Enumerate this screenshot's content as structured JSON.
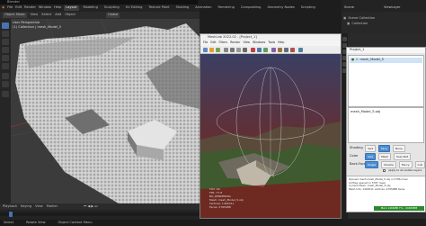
{
  "blender": {
    "title": "Blender",
    "menu": [
      "File",
      "Edit",
      "Render",
      "Window",
      "Help"
    ],
    "workspaces": [
      "Layout",
      "Modeling",
      "Sculpting",
      "UV Editing",
      "Texture Paint",
      "Shading",
      "Animation",
      "Rendering",
      "Compositing",
      "Geometry Nodes",
      "Scripting"
    ],
    "active_workspace": "Layout",
    "header": [
      "Object Mode",
      "View",
      "Select",
      "Add",
      "Object"
    ],
    "transform": "Global",
    "overlay_lines": [
      "User Perspective",
      "(1) Collection | mesh_Model_5"
    ],
    "timeline": [
      "Playback",
      "Keying",
      "View",
      "Marker"
    ],
    "status": [
      "Select",
      "Rotate View",
      "Object Context Menu"
    ],
    "scene": "Scene",
    "viewlayer": "ViewLayer",
    "outliner": [
      "Scene Collection",
      "Collection"
    ]
  },
  "meshlab": {
    "title": "MeshLab 2022.02 - [Project_1]",
    "menu": [
      "File",
      "Edit",
      "Filters",
      "Render",
      "View",
      "Windows",
      "Tools",
      "Help"
    ],
    "info_lines": [
      "FOV: 60",
      "FPS: 77.8",
      "BO_RENDERING",
      "Mesh: mesh_Model_5.obj",
      "Vertices: 1402011",
      "Faces: 2795988"
    ],
    "layer_panel": {
      "title": "Project_1",
      "layer_name": "mesh_Model_5",
      "layer_file": "mesh_Model_5.obj",
      "shading_label": "Shading",
      "shading_opts": [
        "Vert",
        "Face",
        "None"
      ],
      "color_label": "Color",
      "color_opts": [
        "Vert",
        "Mesh",
        "User-Def"
      ],
      "back_face_label": "Back-Face",
      "back_face_opts": [
        "Single",
        "Double",
        "Fancy",
        "Cull"
      ],
      "apply_all": "apply to all visible layers",
      "log": [
        "Opened mesh mesh_Model_5.obj in 5786 msec",
        "All files opened in 5787 msec",
        "Current Mesh: mesh_Model_5.obj",
        "Mesh Info: 1402011 vertices, 2795988 faces"
      ],
      "mem": "Mem 1466MB 7% - 20480MB"
    }
  }
}
